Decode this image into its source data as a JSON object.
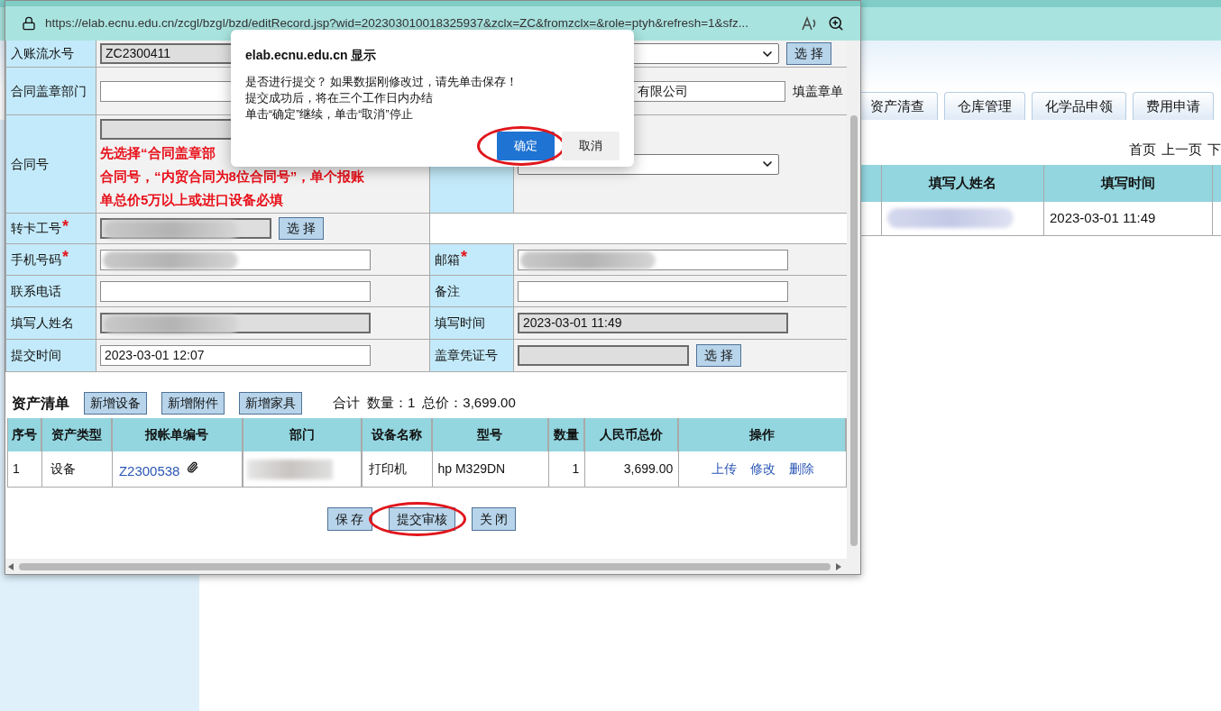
{
  "background_page": {
    "tabs": [
      {
        "label": "资产清查",
        "selected": false
      },
      {
        "label": "仓库管理",
        "selected": false
      },
      {
        "label": "化学品申领",
        "selected": false
      },
      {
        "label": "费用申请",
        "selected": false
      }
    ],
    "pagination": [
      "首页",
      "上一页",
      "下"
    ],
    "table": {
      "columns": [
        "填写人姓名",
        "填写时间"
      ],
      "rows": [
        {
          "cells": [
            {
              "kind": "blurred"
            },
            {
              "kind": "text",
              "text": "2023-03-01 11:49"
            }
          ]
        }
      ]
    }
  },
  "popup": {
    "url": "https://elab.ecnu.edu.cn/zcgl/bzgl/bzd/editRecord.jsp?wid=202303010018325937&zclx=ZC&fromzclx=&role=ptyh&refresh=1&sfz...",
    "form_rows": [
      {
        "left": {
          "label": "入账流水号",
          "input": {
            "kind": "readonly",
            "value": "ZC2300411"
          }
        },
        "right": {
          "input": {
            "kind": "select"
          },
          "button": "选 择"
        }
      },
      {
        "left": {
          "label": "合同盖章部门",
          "input": {
            "kind": "text"
          }
        },
        "right": {
          "input": {
            "kind": "text",
            "value": "有限公司"
          },
          "suffix": "填盖章单"
        }
      },
      {
        "left": {
          "label": "合同号",
          "input": {
            "kind": "readonly"
          },
          "note": [
            "先选择“合同盖章部",
            "合同号，“内贸合同为8位合同号”，单个报账",
            "单总价5万以上或进口设备必填"
          ]
        },
        "right": {
          "input": {
            "kind": "select"
          }
        }
      },
      {
        "left": {
          "label": "转卡工号",
          "required_mark": "*",
          "input": {
            "kind": "readonly",
            "blurred": true
          },
          "button": "选 择"
        }
      },
      {
        "left": {
          "label": "手机号码",
          "required_mark": "*",
          "input": {
            "kind": "text",
            "blurred": true
          }
        },
        "right": {
          "label": "邮箱",
          "required_mark": "*",
          "input": {
            "kind": "text",
            "blurred": true
          }
        }
      },
      {
        "left": {
          "label": "联系电话",
          "input": {
            "kind": "text"
          }
        },
        "right": {
          "label": "备注",
          "input": {
            "kind": "text"
          }
        }
      },
      {
        "left": {
          "label": "填写人姓名",
          "input": {
            "kind": "readonly",
            "blurred": true
          }
        },
        "right": {
          "label": "填写时间",
          "input": {
            "kind": "readonly",
            "value": "2023-03-01 11:49"
          }
        }
      },
      {
        "left": {
          "label": "提交时间",
          "input": {
            "kind": "text",
            "value": "2023-03-01 12:07"
          }
        },
        "right": {
          "label": "盖章凭证号",
          "input": {
            "kind": "readonly"
          },
          "button": "选 择"
        }
      }
    ],
    "assets": {
      "title": "资产清单",
      "buttons": [
        "新增设备",
        "新增附件",
        "新增家具"
      ],
      "summary": [
        "合计",
        "数量：1",
        "总价：3,699.00"
      ],
      "columns": [
        "序号",
        "资产类型",
        "报帐单编号",
        "部门",
        "设备名称",
        "型号",
        "数量",
        "人民币总价",
        "操作"
      ],
      "rows": [
        {
          "index": "1",
          "type": "设备",
          "voucher": "Z2300538",
          "attachment": true,
          "department_blurred": true,
          "name": "打印机",
          "model": "hp M329DN",
          "quantity": "1",
          "total": "3,699.00",
          "actions": [
            "上传",
            "修改",
            "删除"
          ]
        }
      ]
    },
    "footer_buttons": [
      {
        "label": "保 存",
        "circled": false
      },
      {
        "label": "提交审核",
        "circled": true
      },
      {
        "label": "关 闭",
        "circled": false
      }
    ]
  },
  "dialog": {
    "title": "elab.ecnu.edu.cn 显示",
    "message": [
      "是否进行提交？ 如果数据刚修改过，请先单击保存！",
      "提交成功后，将在三个工作日内办结",
      "单击“确定”继续，单击“取消”停止"
    ],
    "buttons": [
      {
        "label": "确定",
        "primary": true,
        "circled": true
      },
      {
        "label": "取消",
        "primary": false,
        "circled": false
      }
    ]
  }
}
